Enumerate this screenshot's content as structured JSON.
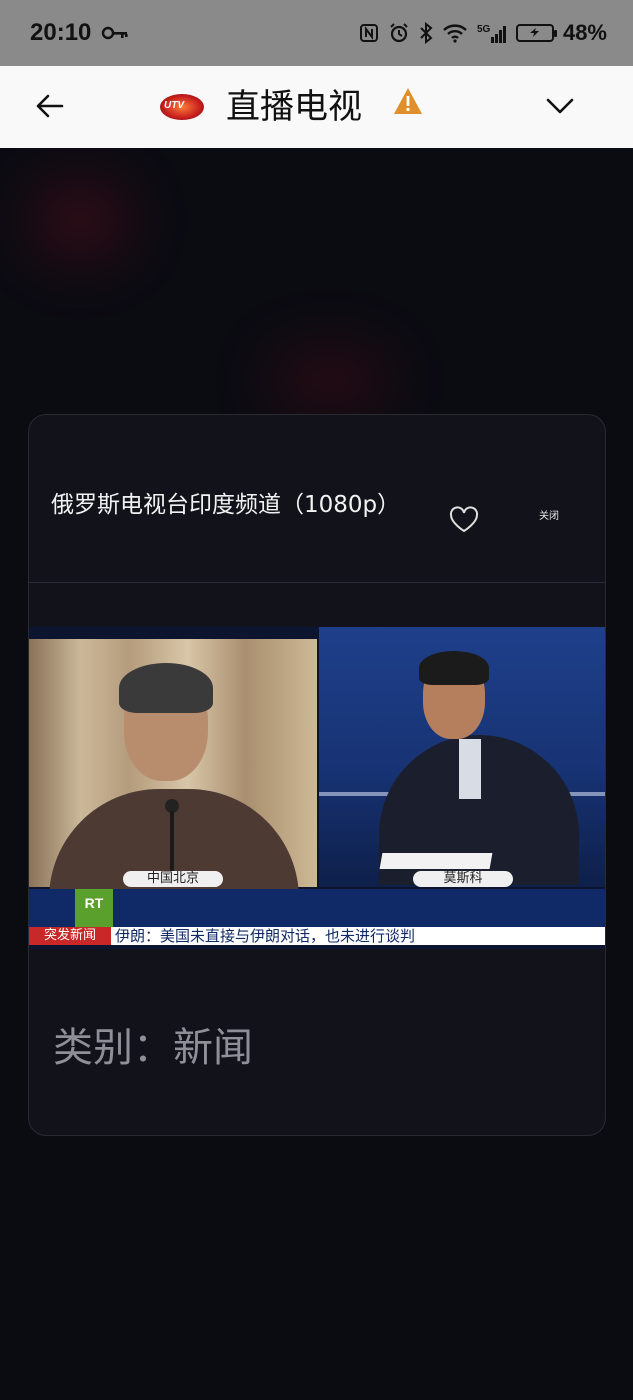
{
  "status_bar": {
    "time": "20:10",
    "battery_percent": "48%",
    "icons": [
      "key-icon",
      "nfc-icon",
      "alarm-icon",
      "bluetooth-icon",
      "wifi-icon",
      "signal-5g-icon",
      "battery-charging-icon"
    ]
  },
  "header": {
    "title": "直播电视",
    "logo_text": "UTV"
  },
  "channel": {
    "title": "俄罗斯电视台印度频道（1080p）",
    "close_label": "关闭",
    "category_text": "类别：新闻"
  },
  "video": {
    "left_location": "中国北京",
    "right_location": "莫斯科",
    "logo": "RT",
    "breaking_label": "突发新闻",
    "ticker_text": "伊朗：美国未直接与伊朗对话，也未进行谈判"
  },
  "colors": {
    "background": "#0b0b12",
    "card": "#12121b",
    "header": "#f9f9f9",
    "status_bar": "#8a8a8a",
    "warning": "#e0902a",
    "breaking_red": "#c82828",
    "rt_green": "#5aa02c"
  }
}
